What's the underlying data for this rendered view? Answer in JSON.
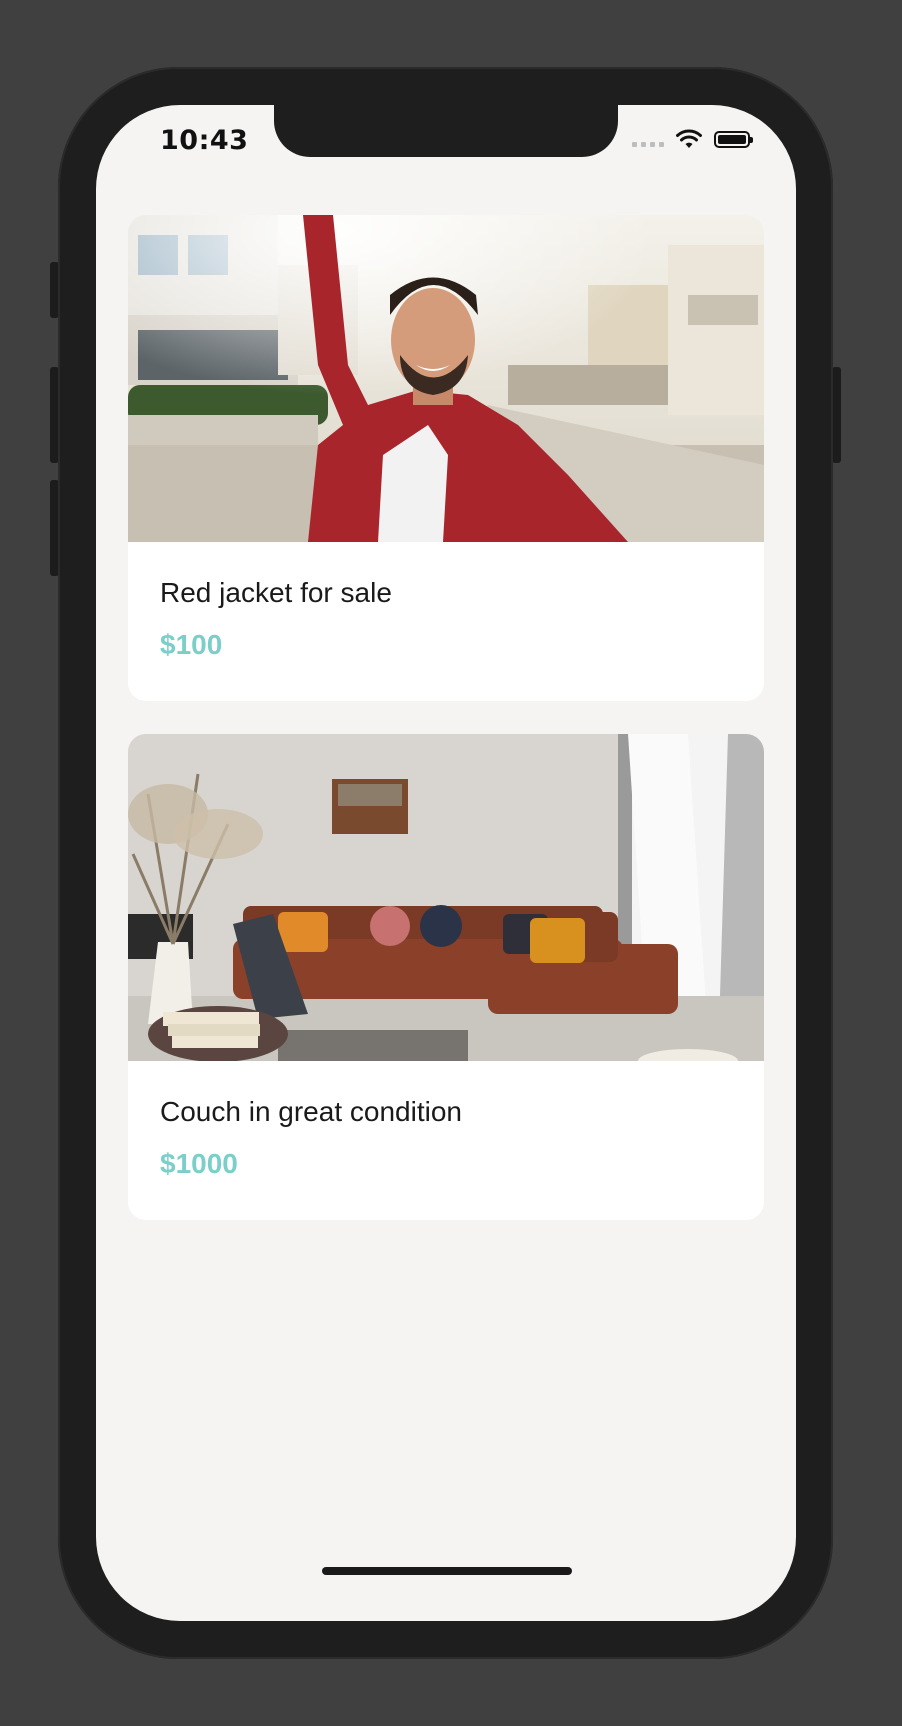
{
  "status_bar": {
    "time": "10:43"
  },
  "listings": [
    {
      "title": "Red jacket for sale",
      "price": "$100",
      "image": "man-in-red-jacket-selfie-photo"
    },
    {
      "title": "Couch in great condition",
      "price": "$1000",
      "image": "living-room-brown-couch-photo"
    }
  ],
  "colors": {
    "price": "#7ccfc9",
    "background": "#f5f4f2",
    "card": "#ffffff"
  }
}
